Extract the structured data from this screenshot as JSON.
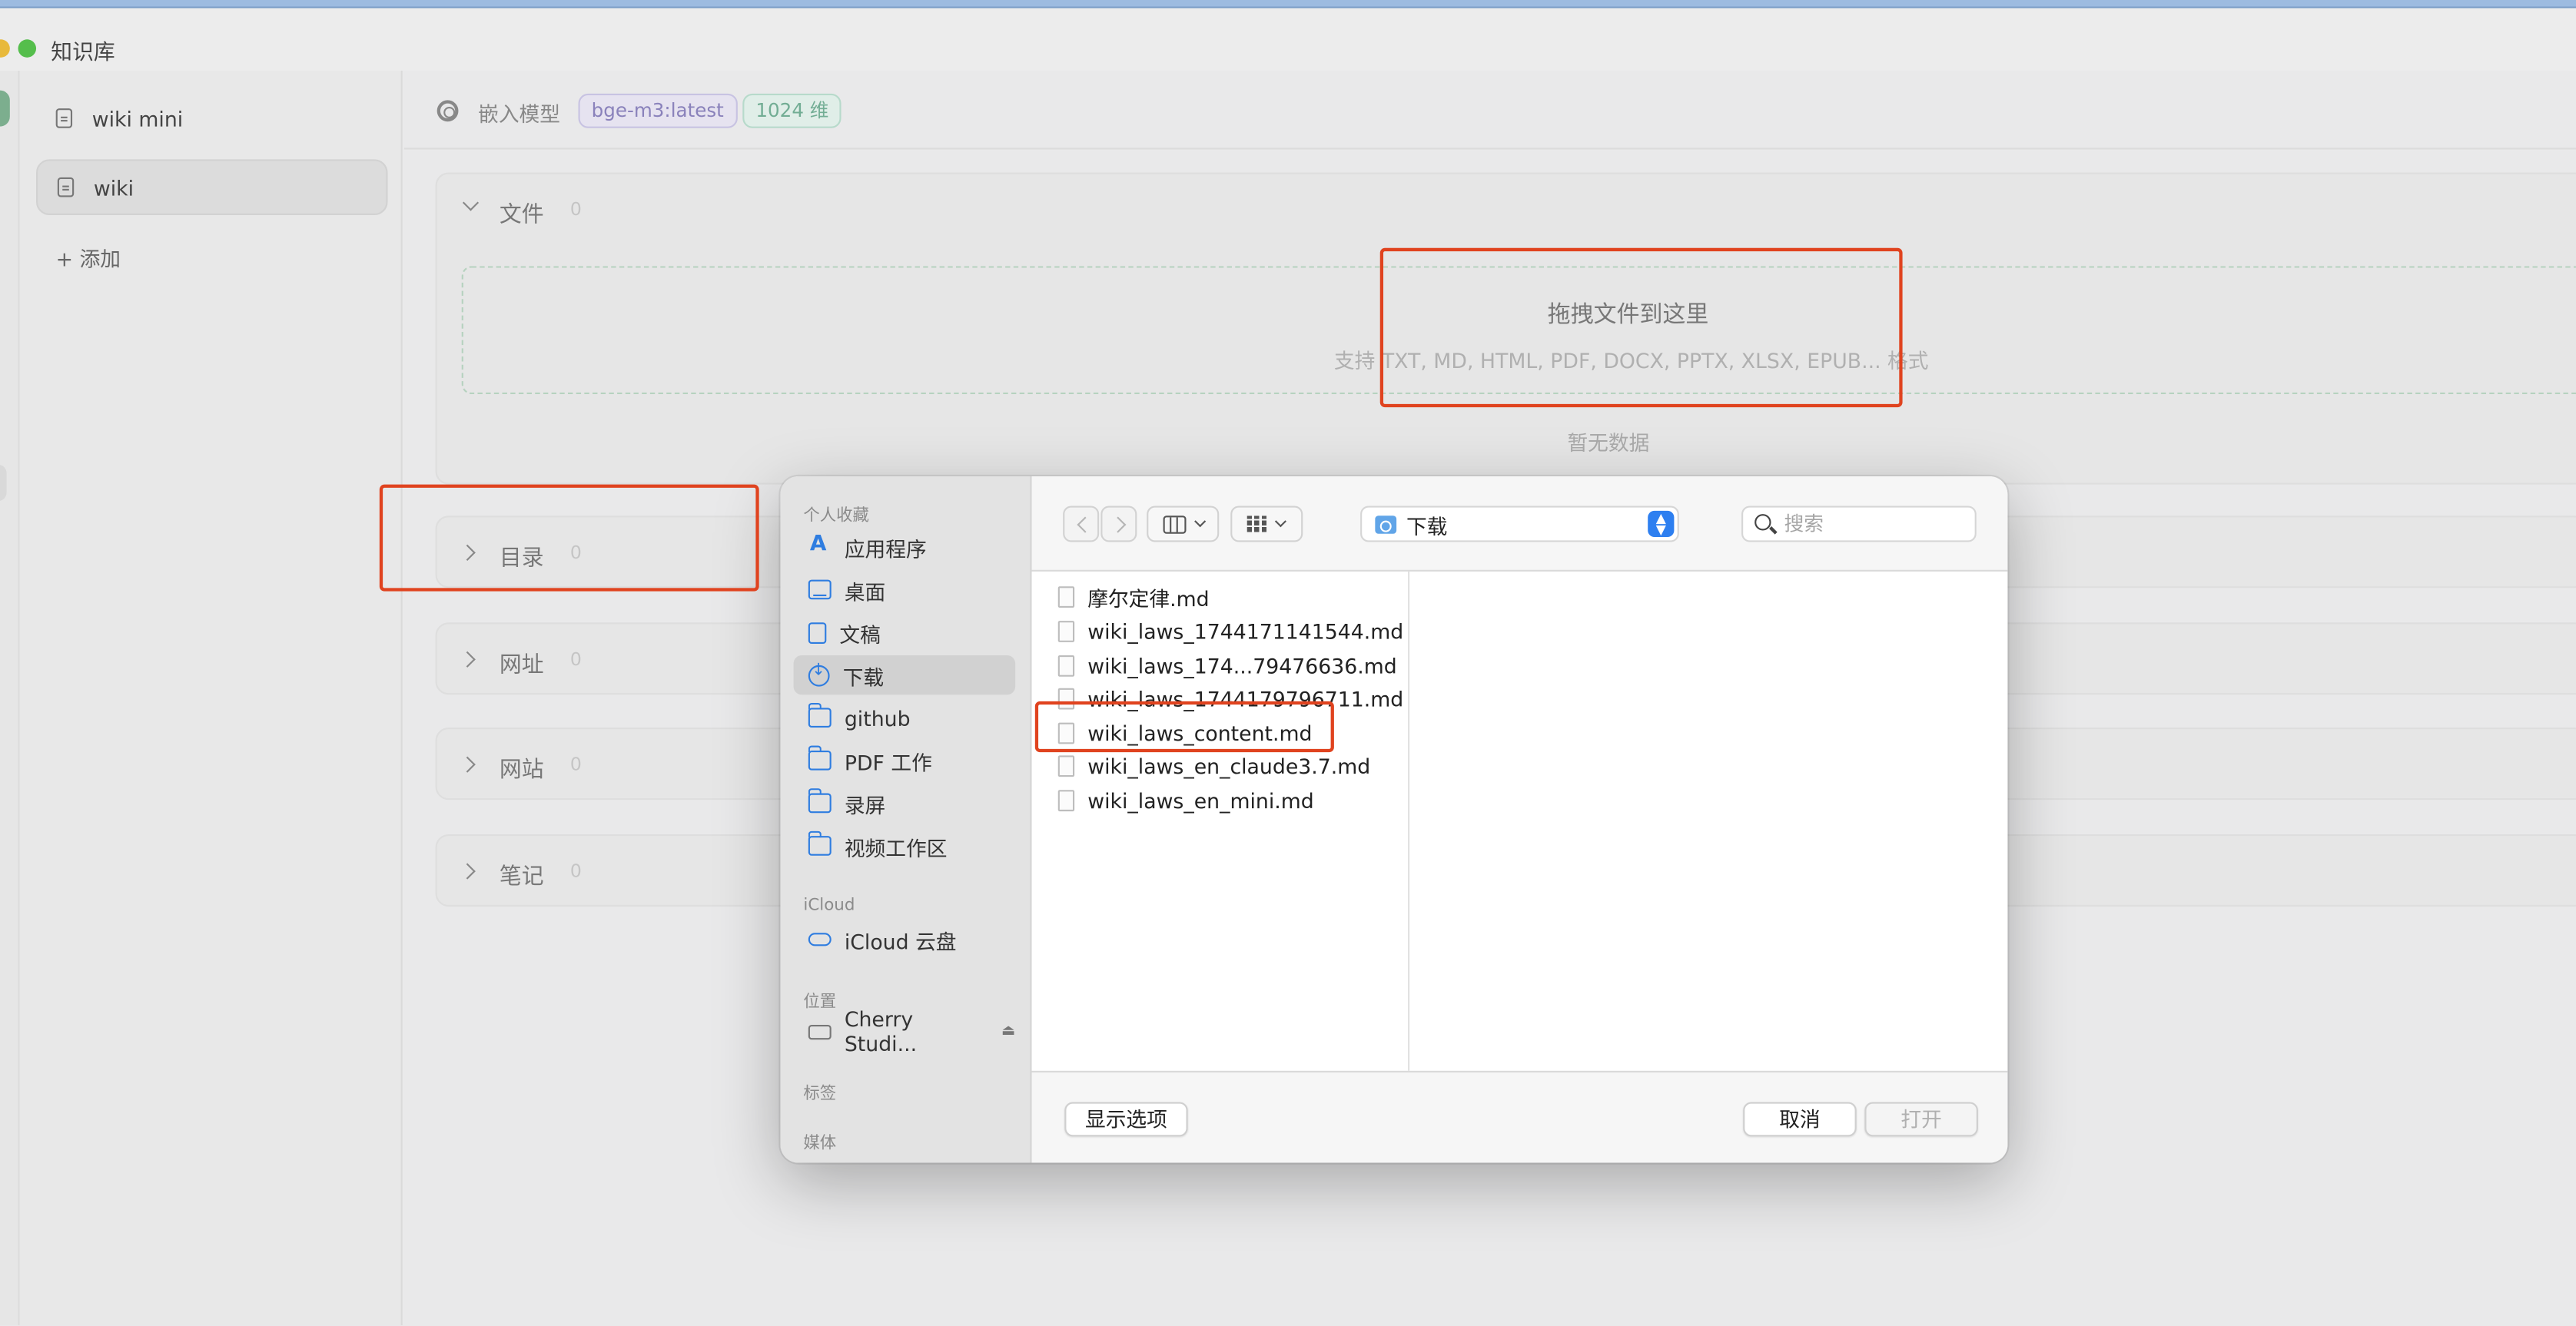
{
  "app": {
    "title": "知识库"
  },
  "sidebar": {
    "items": [
      {
        "label": "wiki mini",
        "active": false
      },
      {
        "label": "wiki",
        "active": true
      }
    ],
    "add_label": "+ 添加"
  },
  "header": {
    "embed_label": "嵌入模型",
    "model_tag": "bge-m3:latest",
    "dim_tag": "1024 维"
  },
  "sections": {
    "files": {
      "title": "文件",
      "count": "0",
      "expanded": true
    },
    "directory": {
      "title": "目录",
      "count": "0"
    },
    "url": {
      "title": "网址",
      "count": "0"
    },
    "website": {
      "title": "网站",
      "count": "0"
    },
    "notes": {
      "title": "笔记",
      "count": "0"
    }
  },
  "dropzone": {
    "title": "拖拽文件到这里",
    "subtitle": "支持 TXT, MD, HTML, PDF, DOCX, PPTX, XLSX, EPUB... 格式",
    "empty": "暂无数据"
  },
  "dialog": {
    "groups": {
      "favorites": "个人收藏",
      "icloud": "iCloud",
      "locations": "位置",
      "tags": "标签",
      "media": "媒体"
    },
    "favorites": [
      {
        "label": "应用程序",
        "icon": "app-icon"
      },
      {
        "label": "桌面",
        "icon": "desktop-icon"
      },
      {
        "label": "文稿",
        "icon": "document-icon"
      },
      {
        "label": "下载",
        "icon": "download-icon",
        "active": true
      },
      {
        "label": "github",
        "icon": "folder-icon"
      },
      {
        "label": "PDF 工作",
        "icon": "folder-icon"
      },
      {
        "label": "录屏",
        "icon": "folder-icon"
      },
      {
        "label": "视频工作区",
        "icon": "folder-icon"
      }
    ],
    "icloud_items": [
      {
        "label": "iCloud 云盘",
        "icon": "cloud-icon"
      }
    ],
    "location_items": [
      {
        "label": "Cherry Studi...",
        "icon": "drive-icon"
      }
    ],
    "location": "下载",
    "search_placeholder": "搜索",
    "files": [
      "摩尔定律.md",
      "wiki_laws_1744171141544.md",
      "wiki_laws_174...79476636.md",
      "wiki_laws_1744179796711.md",
      "wiki_laws_content.md",
      "wiki_laws_en_claude3.7.md",
      "wiki_laws_en_mini.md"
    ],
    "options_button": "显示选项",
    "cancel_button": "取消",
    "open_button": "打开"
  }
}
